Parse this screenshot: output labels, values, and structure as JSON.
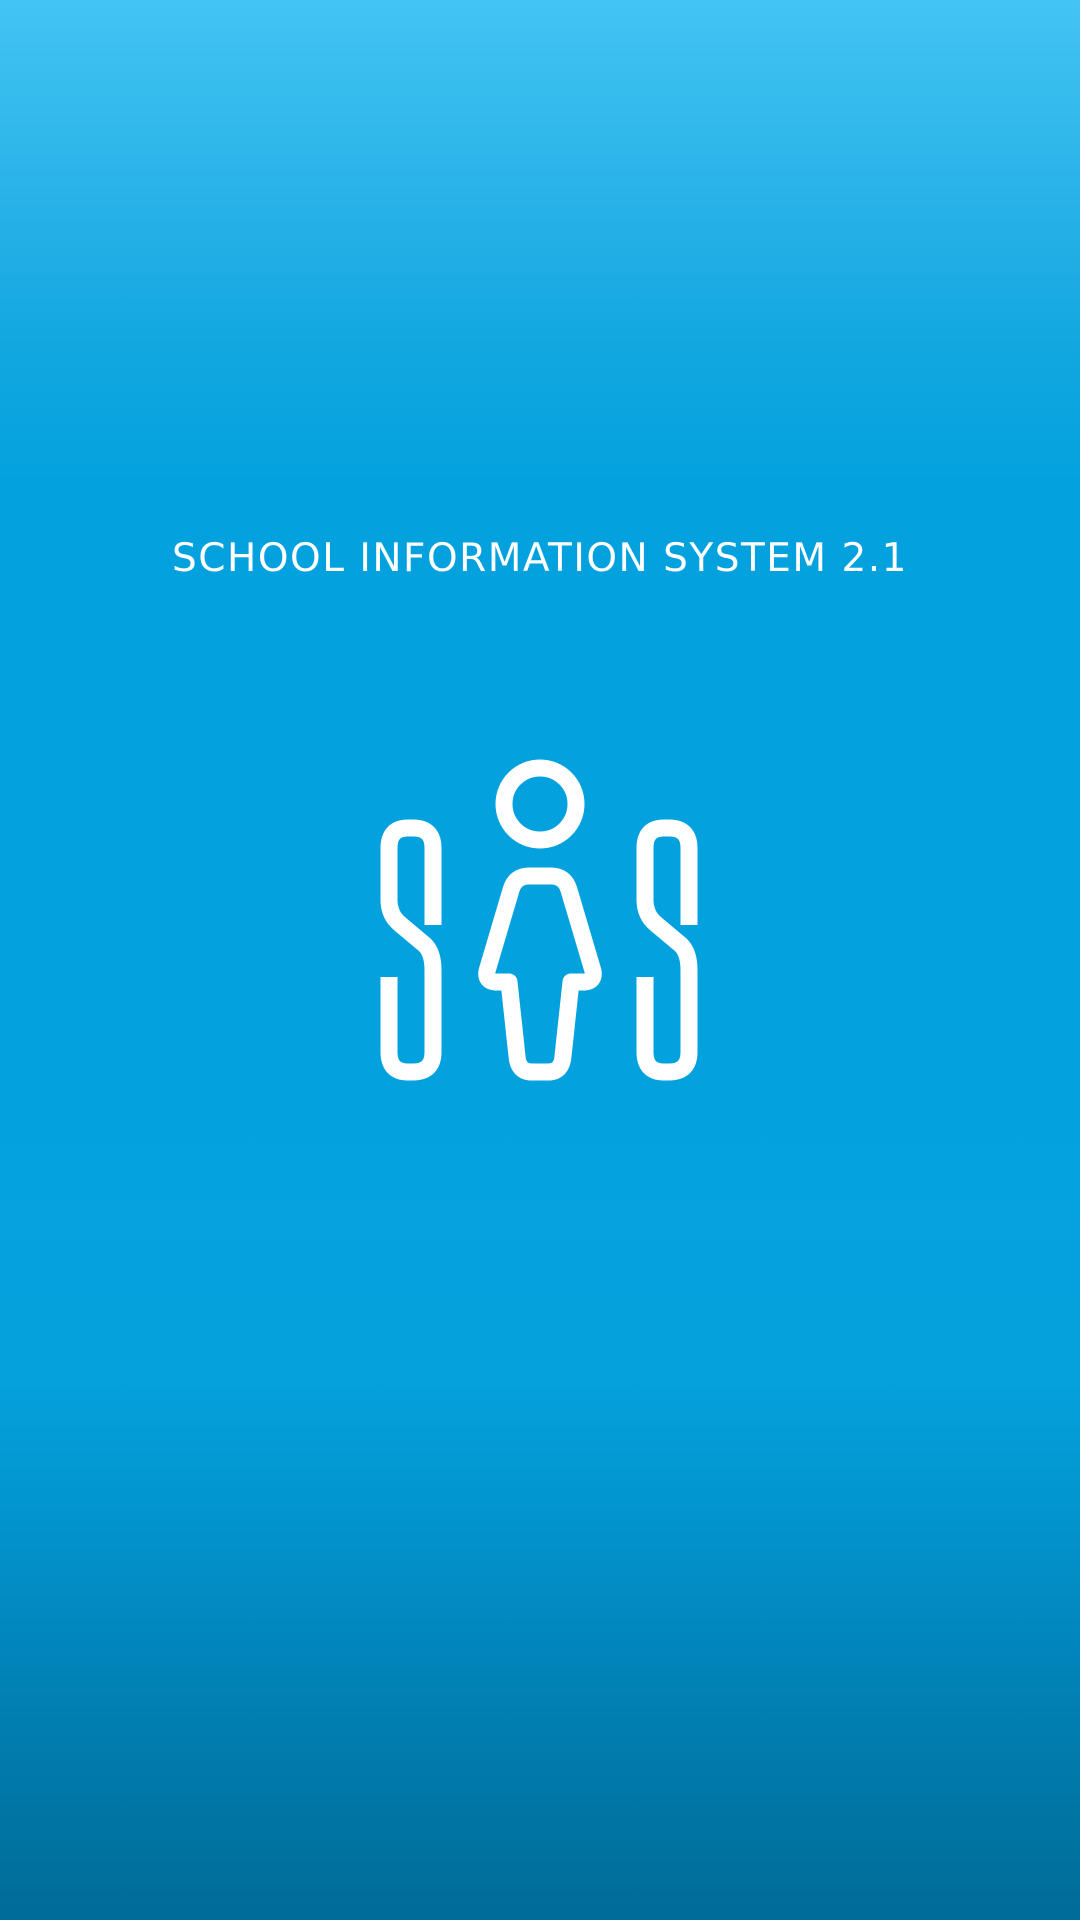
{
  "splash": {
    "title": "SCHOOL INFORMATION SYSTEM 2.1",
    "logo_icon": "sis-person-logo-icon"
  },
  "colors": {
    "gradient_top": "#43c4f4",
    "gradient_mid": "#03a2df",
    "gradient_bottom": "#006c97",
    "foreground": "#ffffff"
  }
}
